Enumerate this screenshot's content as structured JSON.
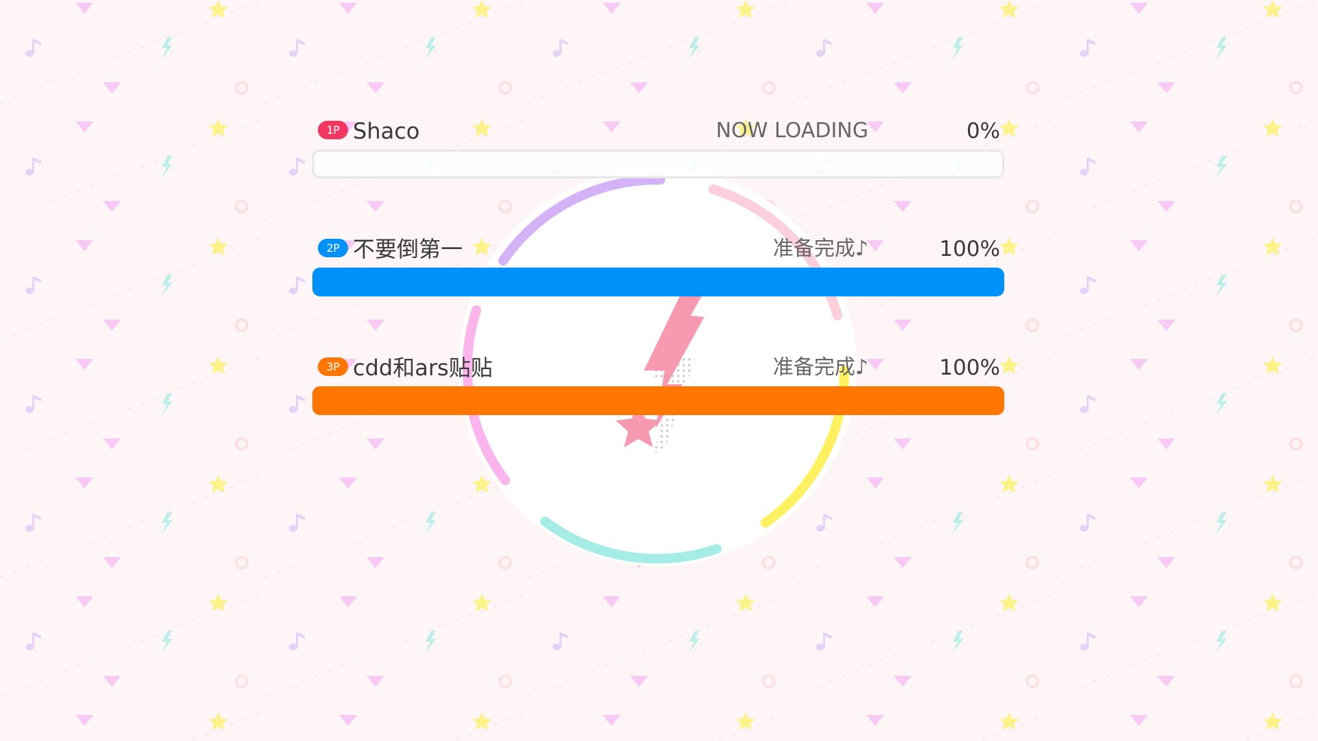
{
  "colors": {
    "background": "#fdf5f6",
    "p1": "#f43761",
    "p2": "#0091fa",
    "p3": "#ff7600",
    "bar_empty": "#ffffff",
    "ring_purple": "#d3b2f7",
    "ring_pink_light": "#fbd0dc",
    "ring_pink": "#fcb4ec",
    "ring_yellow": "#fff060",
    "ring_cyan": "#a6ece6",
    "bolt": "#f79ab1"
  },
  "loader": {
    "icon": "pink-lightning-star-icon"
  },
  "players": [
    {
      "badge": "1P",
      "name": "Shaco",
      "status": "NOW LOADING",
      "percent_label": "0%",
      "progress": 0,
      "color_key": "p1"
    },
    {
      "badge": "2P",
      "name": "不要倒第一",
      "status": "准备完成♪",
      "percent_label": "100%",
      "progress": 1,
      "color_key": "p2"
    },
    {
      "badge": "3P",
      "name": "cdd和ars贴贴",
      "status": "准备完成♪",
      "percent_label": "100%",
      "progress": 1,
      "color_key": "p3"
    }
  ]
}
